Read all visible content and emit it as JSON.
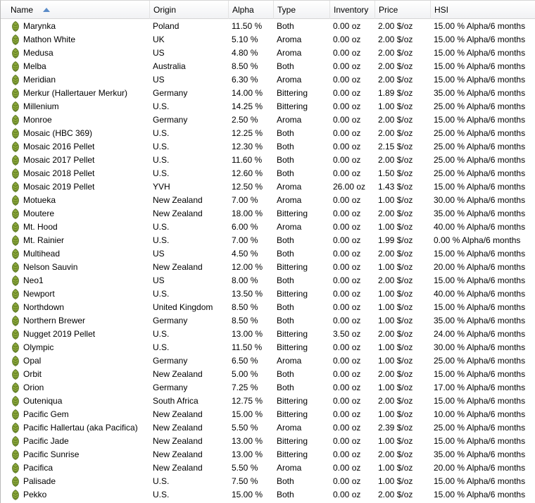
{
  "columns": [
    {
      "key": "name",
      "label": "Name"
    },
    {
      "key": "origin",
      "label": "Origin"
    },
    {
      "key": "alpha",
      "label": "Alpha"
    },
    {
      "key": "type",
      "label": "Type"
    },
    {
      "key": "inventory",
      "label": "Inventory"
    },
    {
      "key": "price",
      "label": "Price"
    },
    {
      "key": "hsi",
      "label": "HSI"
    }
  ],
  "sort": {
    "column": "name",
    "direction": "ascending"
  },
  "row_icon": "hop-icon",
  "colors": {
    "hop_fill": "#8aa63a",
    "hop_stroke": "#4f6b1c",
    "sort_arrow": "#5a8bc8"
  },
  "rows": [
    {
      "name": "Marynka",
      "origin": "Poland",
      "alpha": "11.50 %",
      "type": "Both",
      "inventory": "0.00 oz",
      "price": "2.00 $/oz",
      "hsi": "15.00 % Alpha/6 months"
    },
    {
      "name": "Mathon White",
      "origin": "UK",
      "alpha": "5.10 %",
      "type": "Aroma",
      "inventory": "0.00 oz",
      "price": "2.00 $/oz",
      "hsi": "15.00 % Alpha/6 months"
    },
    {
      "name": "Medusa",
      "origin": "US",
      "alpha": "4.80 %",
      "type": "Aroma",
      "inventory": "0.00 oz",
      "price": "2.00 $/oz",
      "hsi": "15.00 % Alpha/6 months"
    },
    {
      "name": "Melba",
      "origin": "Australia",
      "alpha": "8.50 %",
      "type": "Both",
      "inventory": "0.00 oz",
      "price": "2.00 $/oz",
      "hsi": "15.00 % Alpha/6 months"
    },
    {
      "name": "Meridian",
      "origin": "US",
      "alpha": "6.30 %",
      "type": "Aroma",
      "inventory": "0.00 oz",
      "price": "2.00 $/oz",
      "hsi": "15.00 % Alpha/6 months"
    },
    {
      "name": "Merkur (Hallertauer Merkur)",
      "origin": "Germany",
      "alpha": "14.00 %",
      "type": "Bittering",
      "inventory": "0.00 oz",
      "price": "1.89 $/oz",
      "hsi": "35.00 % Alpha/6 months"
    },
    {
      "name": "Millenium",
      "origin": "U.S.",
      "alpha": "14.25 %",
      "type": "Bittering",
      "inventory": "0.00 oz",
      "price": "1.00 $/oz",
      "hsi": "25.00 % Alpha/6 months"
    },
    {
      "name": "Monroe",
      "origin": "Germany",
      "alpha": "2.50 %",
      "type": "Aroma",
      "inventory": "0.00 oz",
      "price": "2.00 $/oz",
      "hsi": "15.00 % Alpha/6 months"
    },
    {
      "name": "Mosaic (HBC 369)",
      "origin": "U.S.",
      "alpha": "12.25 %",
      "type": "Both",
      "inventory": "0.00 oz",
      "price": "2.00 $/oz",
      "hsi": "25.00 % Alpha/6 months"
    },
    {
      "name": "Mosaic 2016 Pellet",
      "origin": "U.S.",
      "alpha": "12.30 %",
      "type": "Both",
      "inventory": "0.00 oz",
      "price": "2.15 $/oz",
      "hsi": "25.00 % Alpha/6 months"
    },
    {
      "name": "Mosaic 2017 Pellet",
      "origin": "U.S.",
      "alpha": "11.60 %",
      "type": "Both",
      "inventory": "0.00 oz",
      "price": "2.00 $/oz",
      "hsi": "25.00 % Alpha/6 months"
    },
    {
      "name": "Mosaic 2018 Pellet",
      "origin": "U.S.",
      "alpha": "12.60 %",
      "type": "Both",
      "inventory": "0.00 oz",
      "price": "1.50 $/oz",
      "hsi": "25.00 % Alpha/6 months"
    },
    {
      "name": "Mosaic 2019 Pellet",
      "origin": "YVH",
      "alpha": "12.50 %",
      "type": "Aroma",
      "inventory": "26.00 oz",
      "price": "1.43 $/oz",
      "hsi": "15.00 % Alpha/6 months"
    },
    {
      "name": "Motueka",
      "origin": "New Zealand",
      "alpha": "7.00 %",
      "type": "Aroma",
      "inventory": "0.00 oz",
      "price": "1.00 $/oz",
      "hsi": "30.00 % Alpha/6 months"
    },
    {
      "name": "Moutere",
      "origin": "New Zealand",
      "alpha": "18.00 %",
      "type": "Bittering",
      "inventory": "0.00 oz",
      "price": "2.00 $/oz",
      "hsi": "35.00 % Alpha/6 months"
    },
    {
      "name": "Mt. Hood",
      "origin": "U.S.",
      "alpha": "6.00 %",
      "type": "Aroma",
      "inventory": "0.00 oz",
      "price": "1.00 $/oz",
      "hsi": "40.00 % Alpha/6 months"
    },
    {
      "name": "Mt. Rainier",
      "origin": "U.S.",
      "alpha": "7.00 %",
      "type": "Both",
      "inventory": "0.00 oz",
      "price": "1.99 $/oz",
      "hsi": "0.00 % Alpha/6 months"
    },
    {
      "name": "Multihead",
      "origin": "US",
      "alpha": "4.50 %",
      "type": "Both",
      "inventory": "0.00 oz",
      "price": "2.00 $/oz",
      "hsi": "15.00 % Alpha/6 months"
    },
    {
      "name": "Nelson Sauvin",
      "origin": "New Zealand",
      "alpha": "12.00 %",
      "type": "Bittering",
      "inventory": "0.00 oz",
      "price": "1.00 $/oz",
      "hsi": "20.00 % Alpha/6 months"
    },
    {
      "name": "Neo1",
      "origin": "US",
      "alpha": "8.00 %",
      "type": "Both",
      "inventory": "0.00 oz",
      "price": "2.00 $/oz",
      "hsi": "15.00 % Alpha/6 months"
    },
    {
      "name": "Newport",
      "origin": "U.S.",
      "alpha": "13.50 %",
      "type": "Bittering",
      "inventory": "0.00 oz",
      "price": "1.00 $/oz",
      "hsi": "40.00 % Alpha/6 months"
    },
    {
      "name": "Northdown",
      "origin": "United Kingdom",
      "alpha": "8.50 %",
      "type": "Both",
      "inventory": "0.00 oz",
      "price": "1.00 $/oz",
      "hsi": "15.00 % Alpha/6 months"
    },
    {
      "name": "Northern Brewer",
      "origin": "Germany",
      "alpha": "8.50 %",
      "type": "Both",
      "inventory": "0.00 oz",
      "price": "1.00 $/oz",
      "hsi": "35.00 % Alpha/6 months"
    },
    {
      "name": "Nugget 2019 Pellet",
      "origin": "U.S.",
      "alpha": "13.00 %",
      "type": "Bittering",
      "inventory": "3.50 oz",
      "price": "2.00 $/oz",
      "hsi": "24.00 % Alpha/6 months"
    },
    {
      "name": "Olympic",
      "origin": "U.S.",
      "alpha": "11.50 %",
      "type": "Bittering",
      "inventory": "0.00 oz",
      "price": "1.00 $/oz",
      "hsi": "30.00 % Alpha/6 months"
    },
    {
      "name": "Opal",
      "origin": "Germany",
      "alpha": "6.50 %",
      "type": "Aroma",
      "inventory": "0.00 oz",
      "price": "1.00 $/oz",
      "hsi": "25.00 % Alpha/6 months"
    },
    {
      "name": "Orbit",
      "origin": "New Zealand",
      "alpha": "5.00 %",
      "type": "Both",
      "inventory": "0.00 oz",
      "price": "2.00 $/oz",
      "hsi": "15.00 % Alpha/6 months"
    },
    {
      "name": "Orion",
      "origin": "Germany",
      "alpha": "7.25 %",
      "type": "Both",
      "inventory": "0.00 oz",
      "price": "1.00 $/oz",
      "hsi": "17.00 % Alpha/6 months"
    },
    {
      "name": "Outeniqua",
      "origin": "South Africa",
      "alpha": "12.75 %",
      "type": "Bittering",
      "inventory": "0.00 oz",
      "price": "2.00 $/oz",
      "hsi": "15.00 % Alpha/6 months"
    },
    {
      "name": "Pacific Gem",
      "origin": "New Zealand",
      "alpha": "15.00 %",
      "type": "Bittering",
      "inventory": "0.00 oz",
      "price": "1.00 $/oz",
      "hsi": "10.00 % Alpha/6 months"
    },
    {
      "name": "Pacific Hallertau (aka Pacifica)",
      "origin": "New Zealand",
      "alpha": "5.50 %",
      "type": "Aroma",
      "inventory": "0.00 oz",
      "price": "2.39 $/oz",
      "hsi": "25.00 % Alpha/6 months"
    },
    {
      "name": "Pacific Jade",
      "origin": "New Zealand",
      "alpha": "13.00 %",
      "type": "Bittering",
      "inventory": "0.00 oz",
      "price": "1.00 $/oz",
      "hsi": "15.00 % Alpha/6 months"
    },
    {
      "name": "Pacific Sunrise",
      "origin": "New Zealand",
      "alpha": "13.00 %",
      "type": "Bittering",
      "inventory": "0.00 oz",
      "price": "2.00 $/oz",
      "hsi": "35.00 % Alpha/6 months"
    },
    {
      "name": "Pacifica",
      "origin": "New Zealand",
      "alpha": "5.50 %",
      "type": "Aroma",
      "inventory": "0.00 oz",
      "price": "1.00 $/oz",
      "hsi": "20.00 % Alpha/6 months"
    },
    {
      "name": "Palisade",
      "origin": "U.S.",
      "alpha": "7.50 %",
      "type": "Both",
      "inventory": "0.00 oz",
      "price": "1.00 $/oz",
      "hsi": "15.00 % Alpha/6 months"
    },
    {
      "name": "Pekko",
      "origin": "U.S.",
      "alpha": "15.00 %",
      "type": "Both",
      "inventory": "0.00 oz",
      "price": "2.00 $/oz",
      "hsi": "15.00 % Alpha/6 months"
    }
  ]
}
